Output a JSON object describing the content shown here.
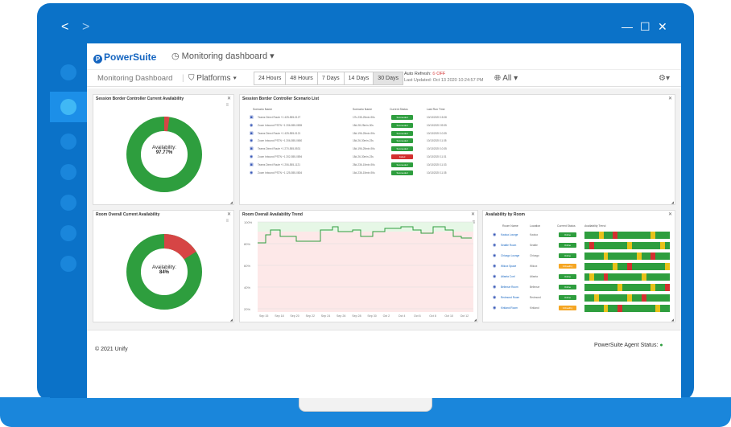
{
  "window": {
    "back_label": "<",
    "forward_label": ">",
    "minimize_label": "—",
    "maximize_label": "☐",
    "close_label": "✕"
  },
  "header": {
    "logo_text": "PowerSuite",
    "dashboard_label": "Monitoring dashboard"
  },
  "toolbar": {
    "breadcrumb": "Monitoring Dashboard",
    "platforms_label": "Platforms",
    "ranges": [
      "24 Hours",
      "48 Hours",
      "7 Days",
      "14 Days",
      "30 Days"
    ],
    "selected_range": "30 Days",
    "auto_refresh_label": "Auto Refresh:",
    "auto_refresh_value": "OFF",
    "last_updated": "Last Updated: Oct 13 2020 10:24:57 PM",
    "scope_label": "All"
  },
  "panels": {
    "sbc_availability": {
      "title": "Session Border Controller Current Availability",
      "label": "Availability:",
      "value": "97.77%",
      "fraction": 0.9777
    },
    "scenario_list": {
      "title": "Session Border Controller Scenario List",
      "columns": [
        "Scenario Name",
        "Scenario Name",
        "Current Status",
        "Last Run Time"
      ],
      "rows": [
        {
          "name": "Teams Direct Route +1 425-555-0127",
          "id": "17b-235-25min-90s",
          "status": "Succeeded",
          "time": "10/13/2020 15:08",
          "color": "#2e9e3e"
        },
        {
          "name": "Zoom Inbound PSTN +1 206-555-0835",
          "id": "18d-28-25min-30s",
          "status": "Succeeded",
          "time": "10/13/2020 09:35",
          "color": "#2e9e3e"
        },
        {
          "name": "Teams Direct Route +1 425-555-0121",
          "id": "18d-196-25min-90s",
          "status": "Succeeded",
          "time": "10/13/2020 10:35",
          "color": "#2e9e3e"
        },
        {
          "name": "Zoom Inbound PSTN +1 206-555-0650",
          "id": "18d-26-30min-23s",
          "status": "Succeeded",
          "time": "10/13/2020 11:35",
          "color": "#2e9e3e"
        },
        {
          "name": "Teams Direct Route +1 270-555-5531",
          "id": "18d-196-25min-90s",
          "status": "Succeeded",
          "time": "10/13/2020 10:35",
          "color": "#2e9e3e"
        },
        {
          "name": "Zoom Inbound PSTN +1 202-555-0894",
          "id": "18d-26-30min-23s",
          "status": "Failed",
          "time": "10/13/2020 11:31",
          "color": "#d32f2f"
        },
        {
          "name": "Teams Direct Route +1 206-555-1121",
          "id": "28d-236-15min-90s",
          "status": "Succeeded",
          "time": "10/13/2020 11:33",
          "color": "#2e9e3e"
        },
        {
          "name": "Zoom Inbound PSTN +1 125-555-0804",
          "id": "16d-236-15min-90s",
          "status": "Succeeded",
          "time": "10/13/2020 11:35",
          "color": "#2e9e3e"
        }
      ]
    },
    "room_availability": {
      "title": "Room Overall Current Availability",
      "label": "Availability:",
      "value": "84%",
      "fraction": 0.84
    },
    "trend": {
      "title": "Room Overall Availability Trend",
      "y_ticks": [
        "100%",
        "80%",
        "60%",
        "40%",
        "20%"
      ],
      "x_ticks": [
        "Sep 15",
        "Sep 18",
        "Sep 20",
        "Sep 22",
        "Sep 24",
        "Sep 26",
        "Sep 28",
        "Sep 30",
        "Oct 2",
        "Oct 4",
        "Oct 6",
        "Oct 8",
        "Oct 10",
        "Oct 12"
      ]
    },
    "room_list": {
      "title": "Availability by Room",
      "columns": [
        "Room Name",
        "Location",
        "Current Status",
        "Availability Trend"
      ],
      "rows": [
        {
          "name": "Kaulua Lounge",
          "location": "Kaulua",
          "status": "Online",
          "color": "#2e9e3e"
        },
        {
          "name": "Seattle Room",
          "location": "Seattle",
          "status": "Online",
          "color": "#2e9e3e"
        },
        {
          "name": "Chicago Lounge",
          "location": "Chicago",
          "status": "Online",
          "color": "#2e9e3e"
        },
        {
          "name": "Wilcox Space",
          "location": "Wilcox",
          "status": "Unhealthy",
          "color": "#f5a623"
        },
        {
          "name": "Atlanta Conf",
          "location": "Atlanta",
          "status": "Online",
          "color": "#2e9e3e"
        },
        {
          "name": "Bellevue Room",
          "location": "Bellevue",
          "status": "Online",
          "color": "#2e9e3e"
        },
        {
          "name": "Redmond Room",
          "location": "Redmond",
          "status": "Online",
          "color": "#2e9e3e"
        },
        {
          "name": "Kirkland Room",
          "location": "Kirkland",
          "status": "Unhealthy",
          "color": "#f5a623"
        }
      ]
    }
  },
  "footer": {
    "copyright": "© 2021 Unify",
    "agent_status": "PowerSuite Agent Status:"
  },
  "colors": {
    "brand": "#0b72c8",
    "ok": "#2e9e3e",
    "fail": "#d32f2f",
    "warn": "#f5a623"
  }
}
